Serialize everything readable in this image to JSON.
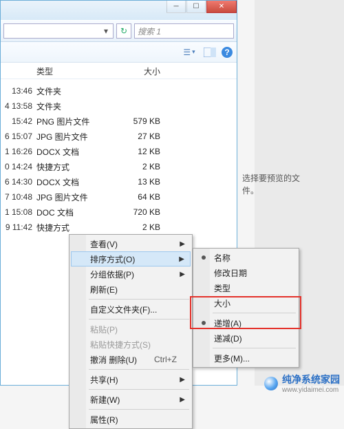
{
  "window": {
    "min_tip": "最小化",
    "max_tip": "最大化",
    "close_tip": "关闭"
  },
  "nav": {
    "search_placeholder": "搜索 1",
    "dropdown_glyph": "▾",
    "refresh_glyph": "↻"
  },
  "toolbar": {
    "view_glyph": "☰",
    "view_dd": "▾",
    "help_glyph": "?"
  },
  "columns": {
    "type": "类型",
    "size": "大小"
  },
  "rows": [
    {
      "time": "13:46",
      "type": "文件夹",
      "size": ""
    },
    {
      "time": "4 13:58",
      "type": "文件夹",
      "size": ""
    },
    {
      "time": "15:42",
      "type": "PNG 图片文件",
      "size": "579 KB"
    },
    {
      "time": "6 15:07",
      "type": "JPG 图片文件",
      "size": "27 KB"
    },
    {
      "time": "1 16:26",
      "type": "DOCX 文档",
      "size": "12 KB"
    },
    {
      "time": "0 14:24",
      "type": "快捷方式",
      "size": "2 KB"
    },
    {
      "time": "6 14:30",
      "type": "DOCX 文档",
      "size": "13 KB"
    },
    {
      "time": "7 10:48",
      "type": "JPG 图片文件",
      "size": "64 KB"
    },
    {
      "time": "1 15:08",
      "type": "DOC 文档",
      "size": "720 KB"
    },
    {
      "time": "9 11:42",
      "type": "快捷方式",
      "size": "2 KB"
    }
  ],
  "preview": {
    "text": "选择要预览的文件。"
  },
  "context_menu": {
    "view": "查看(V)",
    "sort": "排序方式(O)",
    "group": "分组依据(P)",
    "refresh": "刷新(E)",
    "customize": "自定义文件夹(F)...",
    "paste": "粘贴(P)",
    "paste_short": "粘贴快捷方式(S)",
    "undo": "撤消 删除(U)",
    "undo_key": "Ctrl+Z",
    "share": "共享(H)",
    "new": "新建(W)",
    "props": "属性(R)"
  },
  "sort_submenu": {
    "name": "名称",
    "date": "修改日期",
    "type": "类型",
    "size": "大小",
    "asc": "递增(A)",
    "desc": "递减(D)",
    "more": "更多(M)..."
  },
  "watermark": {
    "title": "纯净系统家园",
    "url": "www.yidaimei.com"
  }
}
